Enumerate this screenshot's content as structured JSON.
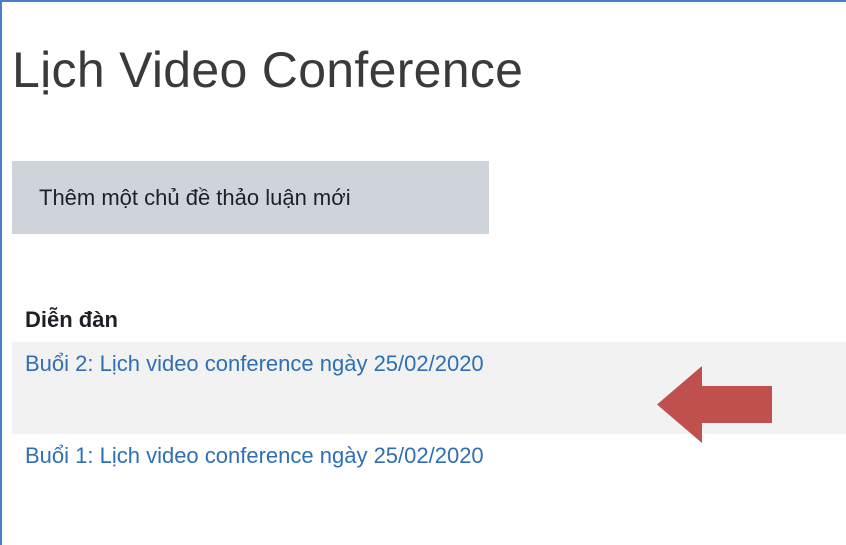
{
  "page": {
    "title": "Lịch Video Conference"
  },
  "actions": {
    "add_topic_label": "Thêm một chủ đề thảo luận mới"
  },
  "forum": {
    "header": "Diễn đàn",
    "discussions": [
      {
        "label": "Buổi 2: Lịch video conference ngày 25/02/2020"
      },
      {
        "label": "Buổi 1: Lịch video conference ngày 25/02/2020"
      }
    ]
  },
  "annotation": {
    "arrow_icon": "left-arrow-icon",
    "arrow_color": "#c0504d"
  },
  "colors": {
    "link": "#2f6fb6",
    "button_bg": "#ced4da",
    "row_highlight": "#f2f2f2",
    "frame_border": "#4a7ec9"
  }
}
